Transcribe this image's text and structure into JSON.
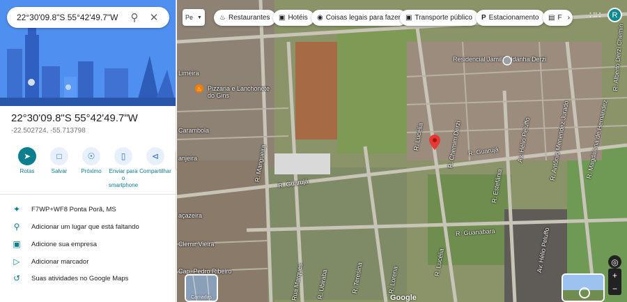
{
  "search": {
    "query": "22°30'09.8\"S 55°42'49.7\"W",
    "search_icon": "search-icon",
    "close_icon": "close-icon"
  },
  "place": {
    "title": "22°30'09.8\"S 55°42'49.7\"W",
    "coords": "-22.502724, -55.713798"
  },
  "actions": [
    {
      "label": "Rotas",
      "icon": "directions-icon"
    },
    {
      "label": "Salvar",
      "icon": "bookmark-icon"
    },
    {
      "label": "Próximo",
      "icon": "nearby-icon"
    },
    {
      "label": "Enviar para o smartphone",
      "icon": "phone-icon"
    },
    {
      "label": "Compartilhar",
      "icon": "share-icon"
    }
  ],
  "info": [
    {
      "text": "F7WP+WF8 Ponta Porã, MS",
      "icon": "plus-code-icon"
    },
    {
      "text": "Adicionar um lugar que está faltando",
      "icon": "add-place-icon"
    },
    {
      "text": "Adicione sua empresa",
      "icon": "add-business-icon"
    },
    {
      "text": "Adicionar marcador",
      "icon": "label-icon"
    },
    {
      "text": "Suas atividades no Google Maps",
      "icon": "history-icon"
    }
  ],
  "chips": [
    {
      "label": "Restaurantes",
      "icon": "restaurant-icon"
    },
    {
      "label": "Hotéis",
      "icon": "hotel-icon"
    },
    {
      "label": "Coisas legais para fazer",
      "icon": "camera-icon"
    },
    {
      "label": "Transporte público",
      "icon": "transit-icon"
    },
    {
      "label": "Estacionamento",
      "icon": "parking-icon"
    },
    {
      "label": "F",
      "icon": "pharmacy-icon"
    }
  ],
  "layers_label": "Pe",
  "avatar_letter": "R",
  "map_labels": {
    "residencial": "Residencial Jamil Saldanha Derzi",
    "pizzaria": "Pizzaria e Lanchonete do Gins",
    "limeira": "Limeira",
    "carambola": "Carambola",
    "anjeira": "anjeira",
    "acazeira": "açazeira",
    "clemir": "Clemir Vieira",
    "cap_pedro": "Cap. Pedro Ribeiro",
    "mangueira": "R. Mangueira",
    "guaruja1": "R. Guarujá",
    "guaruja2": "R. Guarujá",
    "lucelia1": "R. Lucélia",
    "lucelia2": "R. Lucélia",
    "chemim": "R. Chemim Derzi",
    "estefania": "R. Estefânia",
    "helio1": "Av. Hélio Peluffo",
    "helio2": "Av. Hélio Peluffo",
    "antonio": "R. Antônio Menendez Jurado",
    "magdalena": "R. Magdalena de Hernandez",
    "alberto": "R. Alberto Derzi Chemin",
    "guanabara": "R. Guanabara",
    "teresina": "R. Teresina",
    "ubiraba": "R. Ubiraba",
    "lorena": "R. Lorena",
    "marques": "Rua Marques",
    "camadas": "Camadas",
    "google": "Google"
  },
  "colors": {
    "accent": "#0b7f8f",
    "pin": "#e53935",
    "hero": "#4285f4"
  }
}
